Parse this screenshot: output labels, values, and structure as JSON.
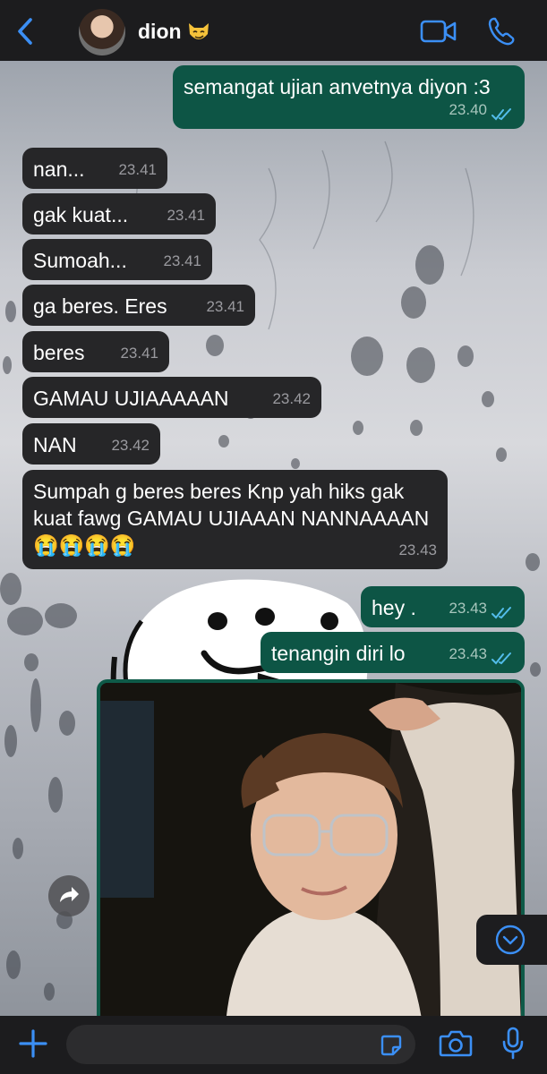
{
  "header": {
    "contact_name": "dion",
    "icons": [
      "chevron-left-icon",
      "avatar",
      "smirking-cat-emoji",
      "video-camera-icon",
      "phone-icon"
    ],
    "accent_color": "#3b8ff5"
  },
  "messages": [
    {
      "dir": "out",
      "text": "semangat ujian anvetnya diyon :3",
      "time": "23.40",
      "read": true
    },
    {
      "dir": "in",
      "text": "nan...",
      "time": "23.41"
    },
    {
      "dir": "in",
      "text": "gak kuat...",
      "time": "23.41"
    },
    {
      "dir": "in",
      "text": "Sumoah...",
      "time": "23.41"
    },
    {
      "dir": "in",
      "text": "ga beres. Eres",
      "time": "23.41"
    },
    {
      "dir": "in",
      "text": "beres",
      "time": "23.41"
    },
    {
      "dir": "in",
      "text": "GAMAU UJIAAAAAN",
      "time": "23.42"
    },
    {
      "dir": "in",
      "text": "NAN",
      "time": "23.42"
    },
    {
      "dir": "in",
      "text": "Sumpah g beres beres Knp yah hiks gak kuat fawg GAMAU UJIAAAN NANNAAAAN😭😭😭😭",
      "time": "23.43"
    },
    {
      "dir": "out",
      "text": "hey .",
      "time": "23.43",
      "read": true
    },
    {
      "dir": "out",
      "text": "tenangin diri lo",
      "time": "23.43",
      "read": true
    }
  ],
  "media": {
    "sticker": "smiling-dog-sticker",
    "photo": "selfie-photo"
  },
  "composer": {
    "placeholder": "",
    "icons": [
      "plus-icon",
      "sticker-icon",
      "camera-icon",
      "microphone-icon"
    ]
  },
  "colors": {
    "outgoing_bubble": "#0d5545",
    "incoming_bubble": "#262628",
    "read_ticks": "#53bdeb",
    "bar_background": "#1c1c1e"
  }
}
